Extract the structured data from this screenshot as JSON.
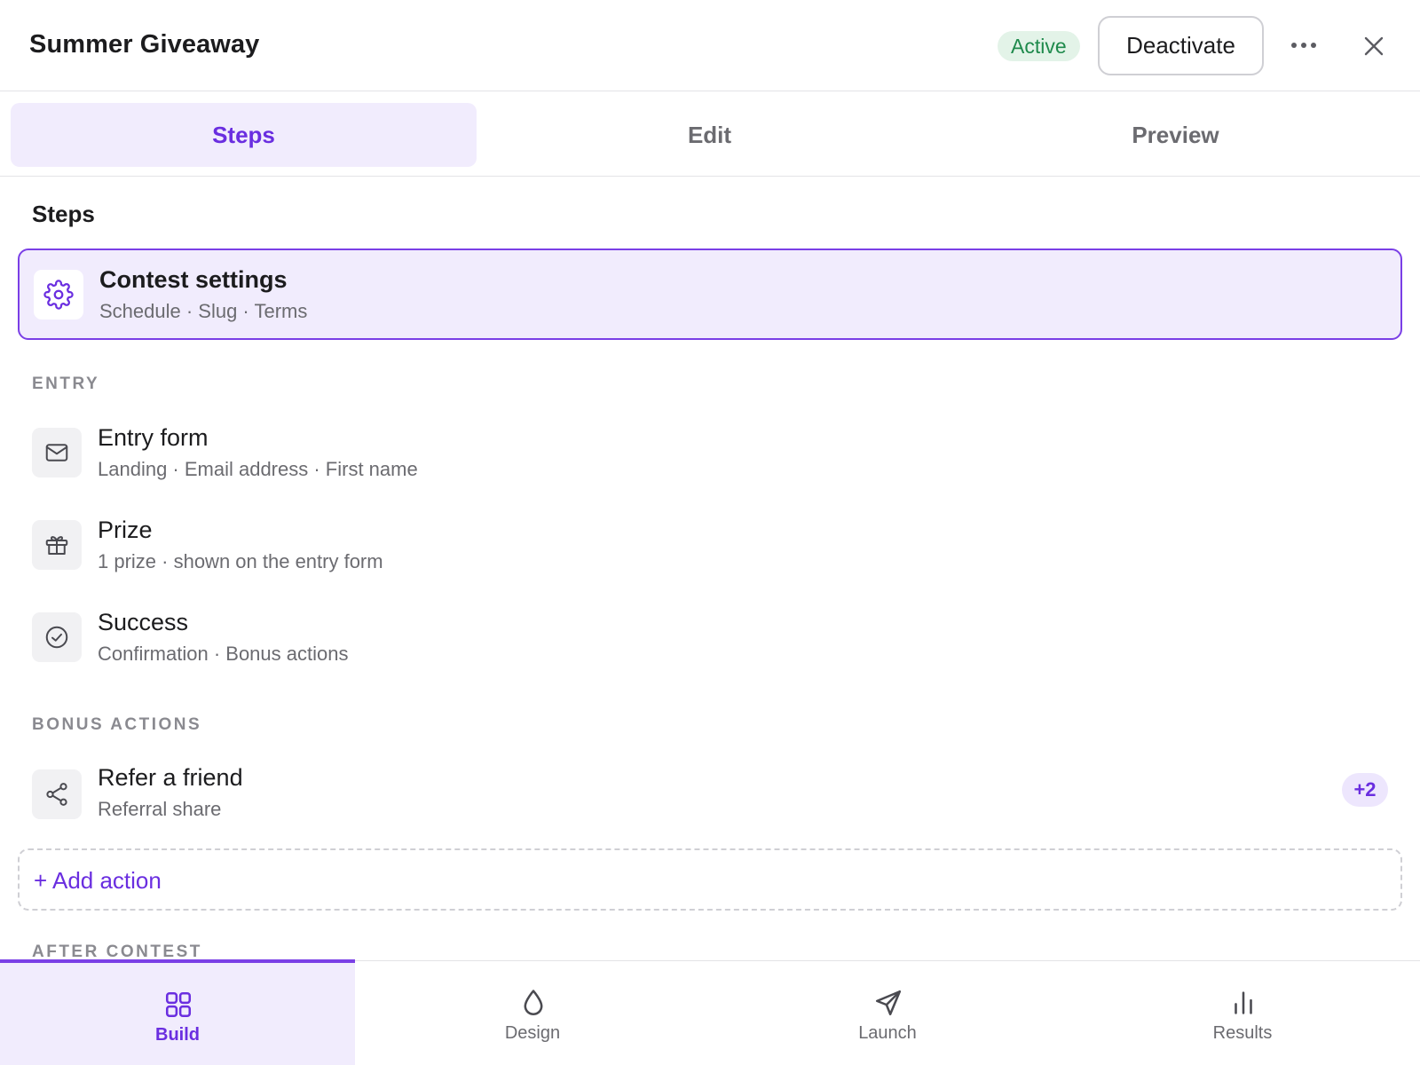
{
  "header": {
    "title": "Summer Giveaway",
    "status": "Active",
    "deactivate_label": "Deactivate"
  },
  "tabs": [
    {
      "label": "Steps",
      "active": true
    },
    {
      "label": "Edit",
      "active": false
    },
    {
      "label": "Preview",
      "active": false
    }
  ],
  "content": {
    "heading": "Steps",
    "selected_step": {
      "title": "Contest settings",
      "subtitle": "Schedule · Slug · Terms",
      "icon": "gear-icon"
    },
    "groups": {
      "entry": {
        "label": "ENTRY",
        "steps": [
          {
            "title": "Entry form",
            "subtitle": "Landing · Email address · First name",
            "icon": "mail-icon"
          },
          {
            "title": "Prize",
            "subtitle": "1 prize · shown on the entry form",
            "icon": "gift-icon"
          },
          {
            "title": "Success",
            "subtitle": "Confirmation · Bonus actions",
            "icon": "check-circle-icon"
          }
        ]
      },
      "bonus_actions": {
        "label": "BONUS ACTIONS",
        "steps": [
          {
            "title": "Refer a friend",
            "subtitle": "Referral share",
            "icon": "share-icon",
            "badge": "+2"
          }
        ],
        "add_label": "+ Add action"
      },
      "after_contest": {
        "label": "AFTER CONTEST"
      }
    }
  },
  "bottom_nav": [
    {
      "label": "Build",
      "icon": "grid-icon",
      "active": true
    },
    {
      "label": "Design",
      "icon": "droplet-icon",
      "active": false
    },
    {
      "label": "Launch",
      "icon": "send-icon",
      "active": false
    },
    {
      "label": "Results",
      "icon": "bar-chart-icon",
      "active": false
    }
  ],
  "colors": {
    "accent": "#6a2ee0",
    "accent_soft": "#f1ecfd",
    "success_text": "#1f8a4c",
    "success_bg": "#e3f3e8",
    "muted_text": "#6b6b70"
  }
}
